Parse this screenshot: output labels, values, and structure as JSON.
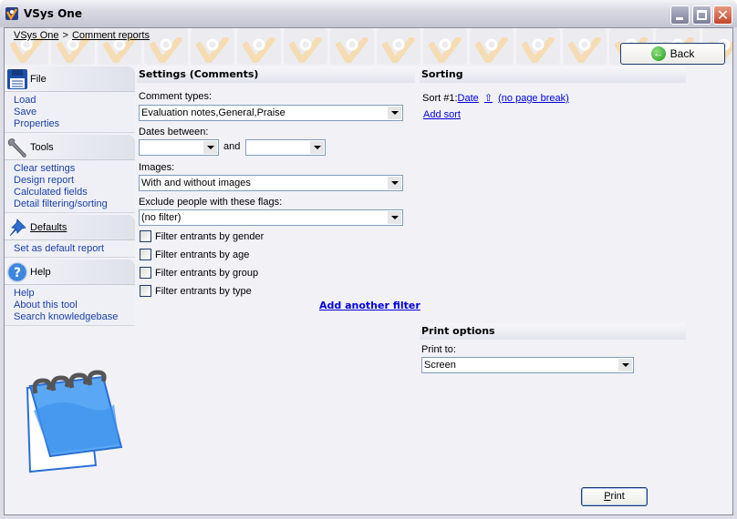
{
  "window": {
    "title": "VSys One",
    "controls": {
      "minimize": "minimize",
      "maximize": "maximize",
      "close": "✕"
    }
  },
  "breadcrumb": {
    "items": [
      "VSys One",
      "Comment reports"
    ],
    "separator": ">"
  },
  "back_button": {
    "label": "Back",
    "icon": "arrow-left-circle-icon"
  },
  "sidebar": {
    "groups": [
      {
        "title": "File",
        "icon": "floppy-disk-icon",
        "items": [
          "Load",
          "Save",
          "Properties"
        ]
      },
      {
        "title": "Tools",
        "icon": "wrench-icon",
        "items": [
          "Clear settings",
          "Design report",
          "Calculated fields",
          "Detail filtering/sorting"
        ]
      },
      {
        "title": "Defaults",
        "icon": "pushpin-icon",
        "items": [
          "Set as default report"
        ]
      },
      {
        "title": "Help",
        "icon": "help-circle-icon",
        "items": [
          "Help",
          "About this tool",
          "Search knowledgebase"
        ]
      }
    ]
  },
  "settings": {
    "title": "Settings (Comments)",
    "comment_types": {
      "label": "Comment types:",
      "value": "Evaluation notes,General,Praise"
    },
    "dates": {
      "label": "Dates between:",
      "from": "",
      "and_label": "and",
      "to": ""
    },
    "images": {
      "label": "Images:",
      "value": "With and without images"
    },
    "flags": {
      "label": "Exclude people with these flags:",
      "value": "(no filter)"
    },
    "filters": [
      {
        "label": "Filter entrants by gender",
        "checked": false
      },
      {
        "label": "Filter entrants by age",
        "checked": false
      },
      {
        "label": "Filter entrants by group",
        "checked": false
      },
      {
        "label": "Filter entrants by type",
        "checked": false
      }
    ],
    "add_filter": "Add another filter"
  },
  "sorting": {
    "title": "Sorting",
    "sort1_label": "Sort #1:",
    "sort1_field": "Date",
    "sort1_direction": "⇧",
    "sort1_break": "(no page break)",
    "add_sort": "Add sort"
  },
  "print_options": {
    "title": "Print options",
    "print_to_label": "Print to:",
    "print_to_value": "Screen"
  },
  "print_button": {
    "label": "Print",
    "accesskey": "P"
  }
}
